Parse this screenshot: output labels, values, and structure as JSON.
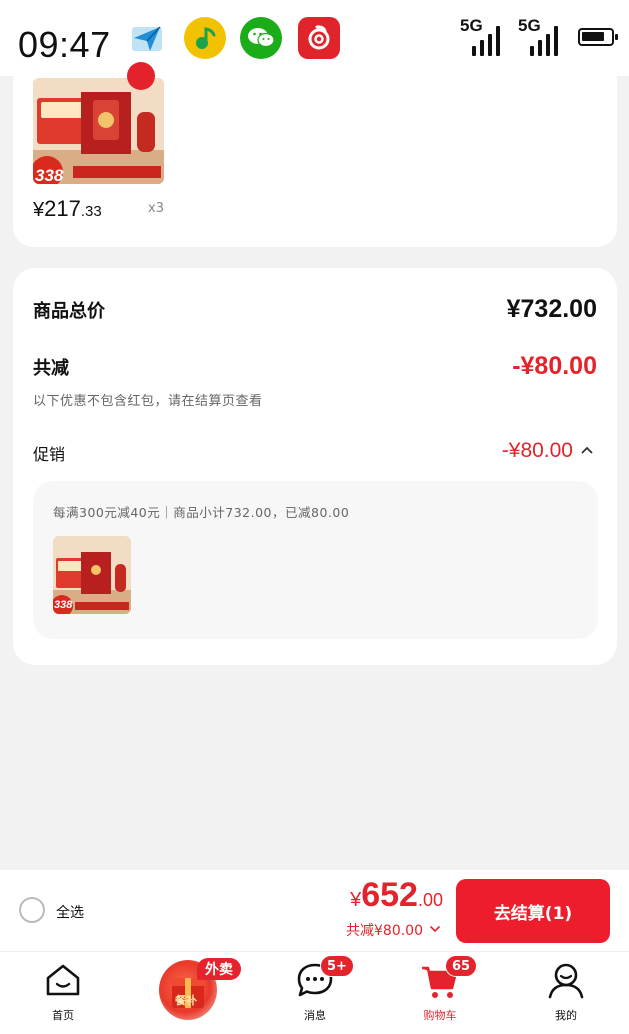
{
  "status_bar": {
    "time": "09:47",
    "network_1": "5G",
    "network_2": "5G",
    "apps": [
      "maps-icon",
      "music-icon",
      "wechat-icon",
      "netease-music-icon"
    ],
    "battery_level": 0.8
  },
  "product": {
    "thumb_badge_price": "338",
    "price_currency": "¥",
    "price_int": "217",
    "price_dec": ".33",
    "quantity": "x3"
  },
  "summary": {
    "total_label": "商品总价",
    "total_value": "¥732.00",
    "discount_label": "共减",
    "discount_value": "-¥80.00",
    "note": "以下优惠不包含红包，请在结算页查看",
    "promo_label": "促销",
    "promo_value": "-¥80.00",
    "promo_desc": "每满300元减40元｜商品小计732.00，已减80.00",
    "promo_thumb_price": "338"
  },
  "checkout": {
    "select_all": "全选",
    "currency": "¥",
    "total_int": "652",
    "total_dec": ".00",
    "discount_text": "共减¥80.00",
    "pay_button": "去结算(1)"
  },
  "tabbar": {
    "items": [
      {
        "label": "首页",
        "icon": "home-icon"
      },
      {
        "label": "",
        "icon": "waimai-icon",
        "pill": "外卖",
        "ball_text": "餐补"
      },
      {
        "label": "消息",
        "icon": "message-icon",
        "badge": "5+"
      },
      {
        "label": "购物车",
        "icon": "cart-icon",
        "badge": "65"
      },
      {
        "label": "我的",
        "icon": "profile-icon"
      }
    ]
  },
  "colors": {
    "accent": "#e4232c",
    "background": "#f2f2f2"
  }
}
